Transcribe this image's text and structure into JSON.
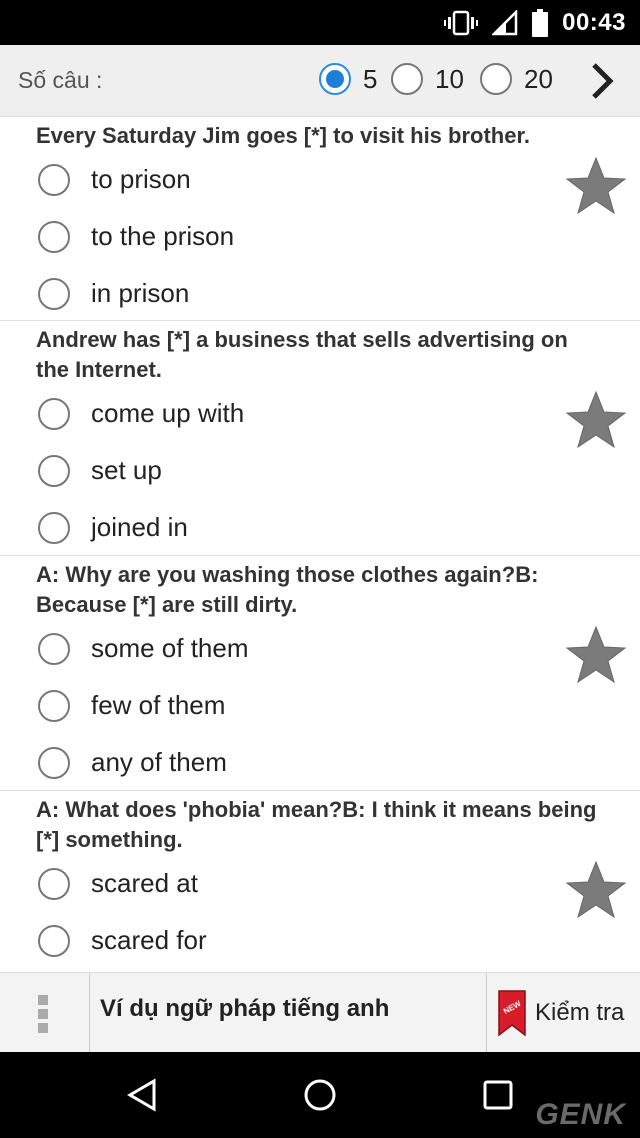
{
  "status": {
    "time": "00:43"
  },
  "toolbar": {
    "count_label": "Số câu :",
    "options": [
      {
        "label": "5",
        "selected": true
      },
      {
        "label": "10",
        "selected": false
      },
      {
        "label": "20",
        "selected": false
      }
    ],
    "next_icon": "chevron-right-icon"
  },
  "questions": [
    {
      "text": "Every Saturday Jim goes [*] to visit his brother.",
      "answers": [
        "to prison",
        "to the prison",
        "in prison"
      ]
    },
    {
      "text": "Andrew has [*] a business that sells advertising on the Internet.",
      "answers": [
        "come up with",
        "set up",
        "joined in"
      ]
    },
    {
      "text": "A: Why are you washing those clothes again?B: Because [*] are still dirty.",
      "answers": [
        "some of them",
        "few of them",
        "any of them"
      ]
    },
    {
      "text": "A: What does 'phobia' mean?B: I think it means being [*] something.",
      "answers": [
        "scared at",
        "scared for"
      ]
    }
  ],
  "bottom_bar": {
    "title": "Ví dụ ngữ pháp tiếng anh",
    "check_label": "Kiểm tra",
    "new_badge": "NEW"
  },
  "watermark": "GENK"
}
